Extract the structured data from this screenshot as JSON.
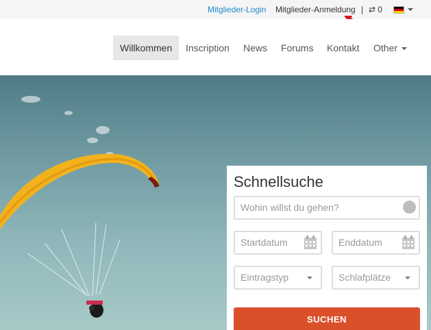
{
  "topbar": {
    "login": "Mitglieder-Login",
    "register": "Mitglieder-Anmeldung",
    "separator": "|",
    "compare_count": "0",
    "compare_icon": "swap-icon",
    "language_icon": "german-flag-icon",
    "login_color": "#1e88c8"
  },
  "nav": {
    "items": [
      {
        "label": "Willkommen",
        "active": true
      },
      {
        "label": "Inscription"
      },
      {
        "label": "News"
      },
      {
        "label": "Forums"
      },
      {
        "label": "Kontakt"
      },
      {
        "label": "Other",
        "dropdown": true
      }
    ]
  },
  "search": {
    "title": "Schnellsuche",
    "where_placeholder": "Wohin willst du gehen?",
    "start_placeholder": "Startdatum",
    "end_placeholder": "Enddatum",
    "type_label": "Eintragstyp",
    "sleep_label": "Schlafplätze",
    "button": "SUCHEN",
    "button_color": "#d9502a"
  }
}
